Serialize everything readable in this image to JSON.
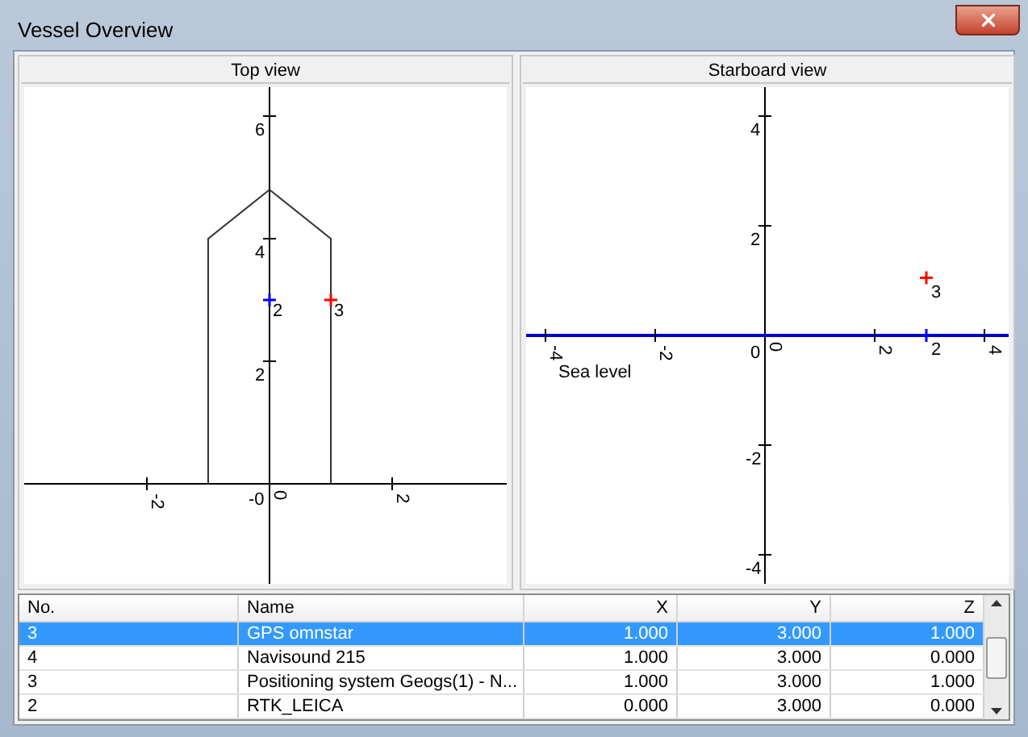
{
  "window": {
    "title": "Vessel Overview"
  },
  "top_view": {
    "title": "Top view",
    "x_ticks": [
      "-2",
      "2"
    ],
    "y_ticks": [
      "6",
      "4",
      "2"
    ],
    "origin_labels": [
      "-0",
      "0"
    ],
    "points": [
      {
        "label": "2",
        "color": "#0000ff"
      },
      {
        "label": "3",
        "color": "#ff0000"
      }
    ]
  },
  "starboard_view": {
    "title": "Starboard view",
    "x_ticks": [
      "-4",
      "-2",
      "2",
      "4"
    ],
    "y_ticks": [
      "4",
      "2",
      "-2",
      "-4"
    ],
    "origin_labels": [
      "0",
      "0"
    ],
    "sea_level": "Sea level",
    "points": [
      {
        "label": "3",
        "color": "#ff0000"
      },
      {
        "label": "2",
        "color": "#0000ff"
      }
    ]
  },
  "table": {
    "columns": [
      "No.",
      "Name",
      "X",
      "Y",
      "Z"
    ],
    "rows": [
      {
        "cells": [
          "3",
          "GPS omnstar",
          "1.000",
          "3.000",
          "1.000"
        ],
        "selected": true
      },
      {
        "cells": [
          "4",
          "Navisound 215",
          "1.000",
          "3.000",
          "0.000"
        ],
        "selected": false
      },
      {
        "cells": [
          "3",
          "Positioning system Geogs(1) - N...",
          "1.000",
          "3.000",
          "1.000"
        ],
        "selected": false
      },
      {
        "cells": [
          "2",
          "RTK_LEICA",
          "0.000",
          "3.000",
          "0.000"
        ],
        "selected": false
      }
    ]
  }
}
